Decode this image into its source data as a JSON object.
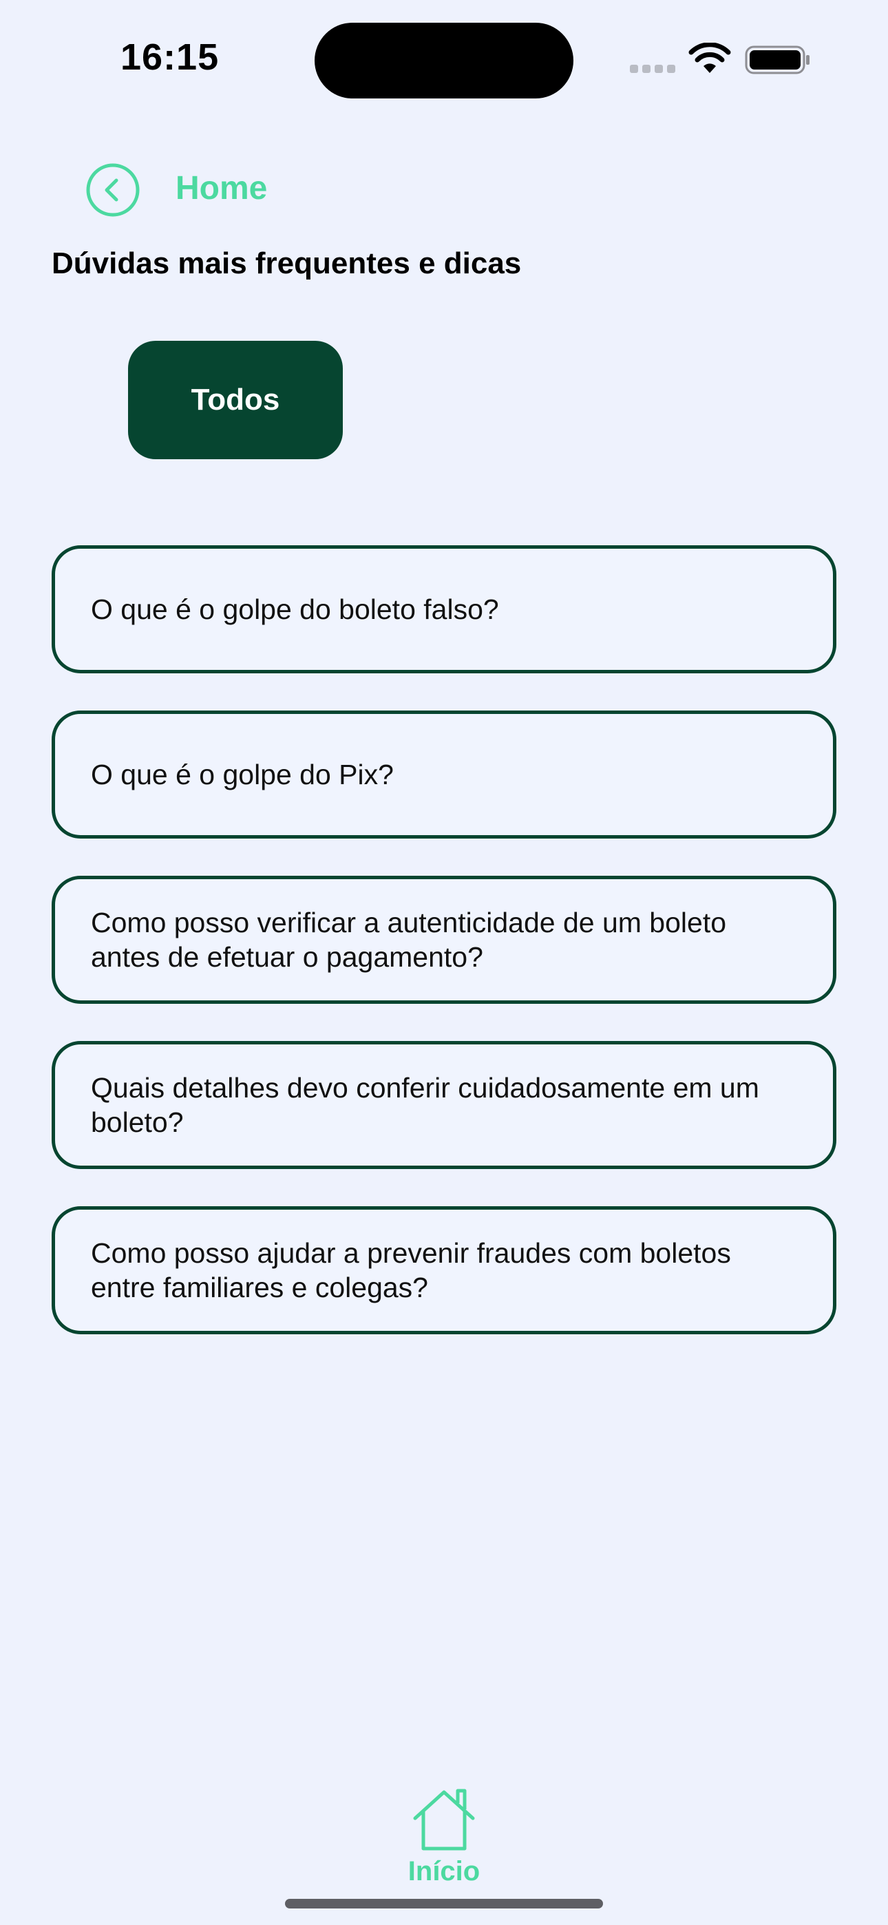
{
  "status_bar": {
    "time": "16:15"
  },
  "header": {
    "back_label": "Home",
    "back_icon": "chevron-left-circle-icon",
    "title": "Dúvidas mais frequentes e dicas"
  },
  "filters": {
    "selected": "Todos"
  },
  "faq": [
    {
      "question": "O que é o golpe do boleto falso?"
    },
    {
      "question": "O que é o golpe do Pix?"
    },
    {
      "question": "Como posso verificar a autenticidade de um boleto antes de efetuar o pagamento?"
    },
    {
      "question": "Quais detalhes devo conferir cuidadosamente em um boleto?"
    },
    {
      "question": "Como posso ajudar a prevenir fraudes com boletos entre familiares e colegas?"
    }
  ],
  "tab_bar": {
    "home_label": "Início",
    "home_icon": "house-icon"
  },
  "colors": {
    "background": "#eef2fd",
    "accent": "#4cd9a0",
    "primary_dark": "#064530"
  }
}
